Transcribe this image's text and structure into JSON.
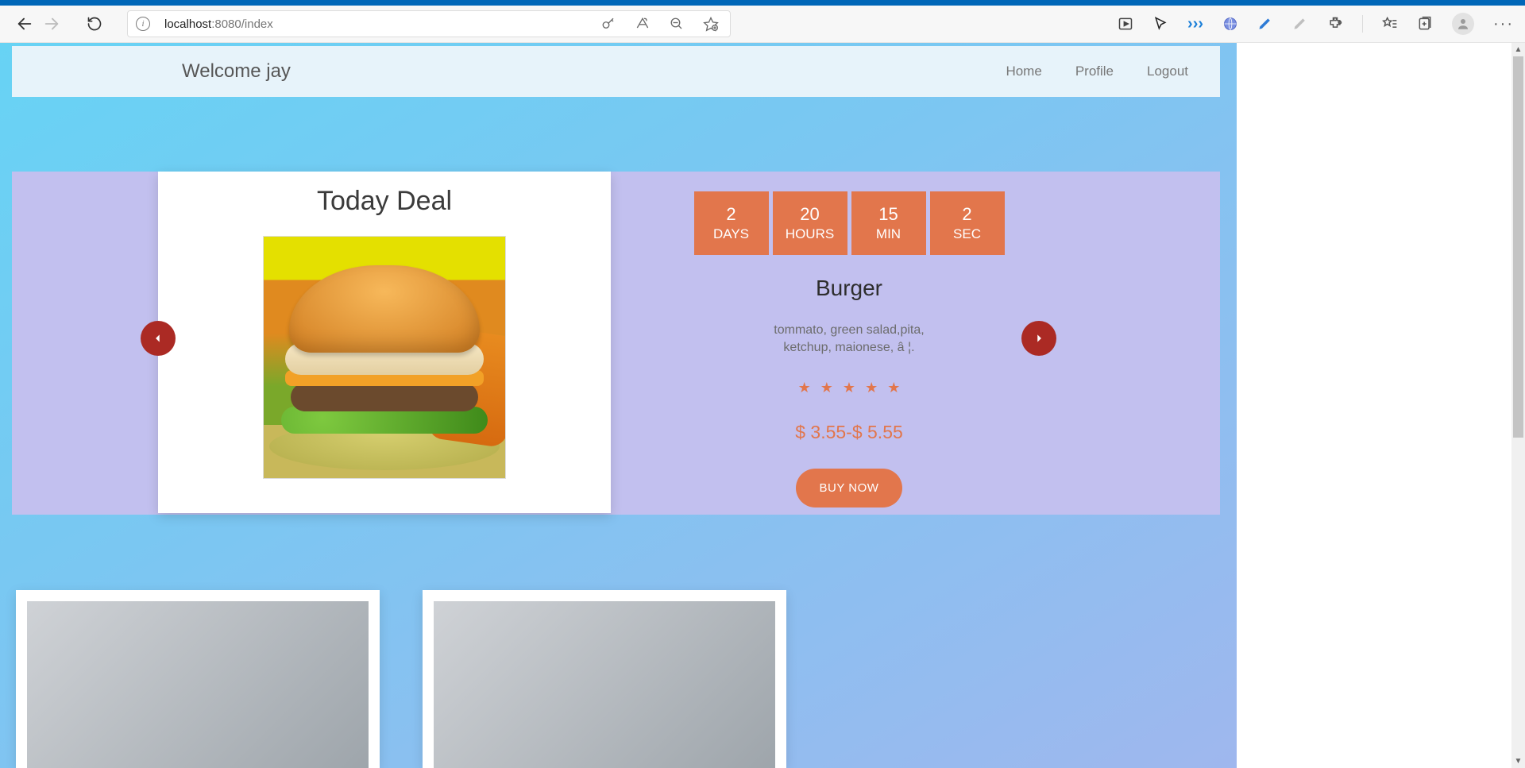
{
  "browser": {
    "url_host": "localhost",
    "url_rest": ":8080/index"
  },
  "nav": {
    "welcome": "Welcome jay",
    "links": [
      "Home",
      "Profile",
      "Logout"
    ]
  },
  "deal": {
    "heading": "Today Deal",
    "countdown": [
      {
        "value": "2",
        "label": "DAYS"
      },
      {
        "value": "20",
        "label": "HOURS"
      },
      {
        "value": "15",
        "label": "MIN"
      },
      {
        "value": "2",
        "label": "SEC"
      }
    ],
    "product_name": "Burger",
    "description": "tommato, green salad,pita, ketchup, maionese, â ¦.",
    "rating": 5,
    "price": "$ 3.55-$ 5.55",
    "buy_label": "BUY NOW"
  }
}
